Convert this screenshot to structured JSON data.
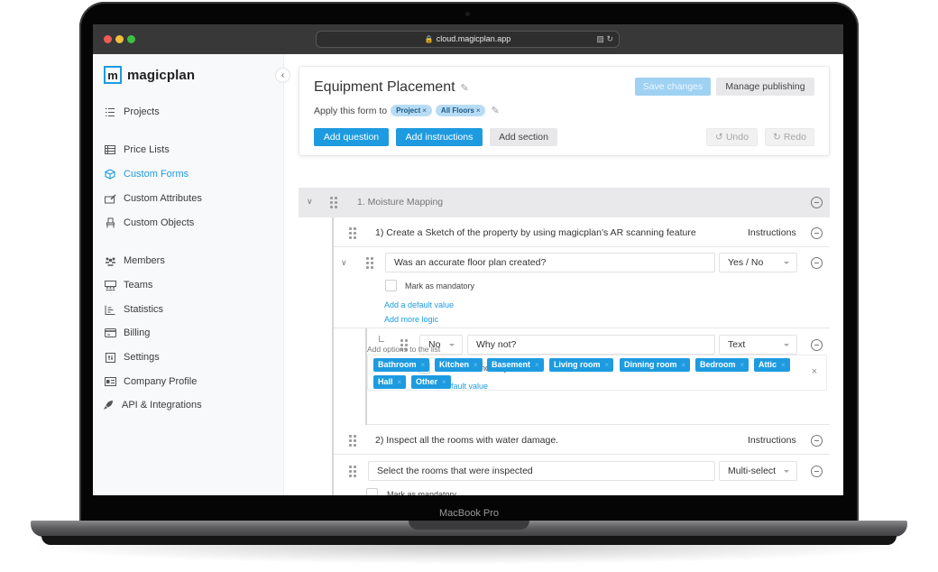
{
  "device": {
    "label": "MacBook Pro"
  },
  "browser": {
    "url": "cloud.magicplan.app"
  },
  "sidebar": {
    "logo_mark": "m",
    "logo_text": "magicplan",
    "items": [
      {
        "label": "Projects",
        "icon": "list-check-icon",
        "active": false
      },
      {
        "label": "Price Lists",
        "icon": "table-icon",
        "active": false
      },
      {
        "label": "Custom Forms",
        "icon": "cube-icon",
        "active": true
      },
      {
        "label": "Custom Attributes",
        "icon": "edit-tag-icon",
        "active": false
      },
      {
        "label": "Custom Objects",
        "icon": "chair-icon",
        "active": false
      },
      {
        "label": "Members",
        "icon": "members-icon",
        "active": false
      },
      {
        "label": "Teams",
        "icon": "teams-icon",
        "active": false
      },
      {
        "label": "Statistics",
        "icon": "chart-icon",
        "active": false
      },
      {
        "label": "Billing",
        "icon": "credit-card-icon",
        "active": false
      },
      {
        "label": "Settings",
        "icon": "settings-icon",
        "active": false
      },
      {
        "label": "Company Profile",
        "icon": "id-card-icon",
        "active": false
      },
      {
        "label": "API & Integrations",
        "icon": "rocket-icon",
        "active": false
      }
    ]
  },
  "header": {
    "title": "Equipment Placement",
    "apply_label": "Apply this form to",
    "apply_chips": [
      "Project",
      "All Floors"
    ],
    "save_label": "Save changes",
    "publish_label": "Manage publishing",
    "add_question_label": "Add question",
    "add_instructions_label": "Add instructions",
    "add_section_label": "Add section",
    "undo_label": "Undo",
    "redo_label": "Redo"
  },
  "section": {
    "title": "1. Moisture Mapping",
    "instruction_1": {
      "text": "1) Create a Sketch of the property by using magicplan's AR scanning feature",
      "tag": "Instructions"
    },
    "question_1": {
      "text": "Was an accurate floor plan created?",
      "type": "Yes / No",
      "mandatory_label": "Mark as mandatory",
      "default_link": "Add a default value",
      "logic_link": "Add more logic"
    },
    "subquestion_1": {
      "condition": "No",
      "text": "Why not?",
      "type": "Text",
      "mandatory_label": "Mark as mandatory",
      "default_link": "Add a default value"
    },
    "instruction_2": {
      "text": "2) Inspect all the rooms with water damage.",
      "tag": "Instructions"
    },
    "question_2": {
      "text": "Select the rooms that were inspected",
      "type": "Multi-select",
      "mandatory_label": "Mark as mandatory",
      "options_label": "Add options to the list",
      "options": [
        "Bathroom",
        "Kitchen",
        "Basement",
        "Living room",
        "Dinning room",
        "Bedroom",
        "Attic",
        "Hall",
        "Other"
      ]
    }
  }
}
